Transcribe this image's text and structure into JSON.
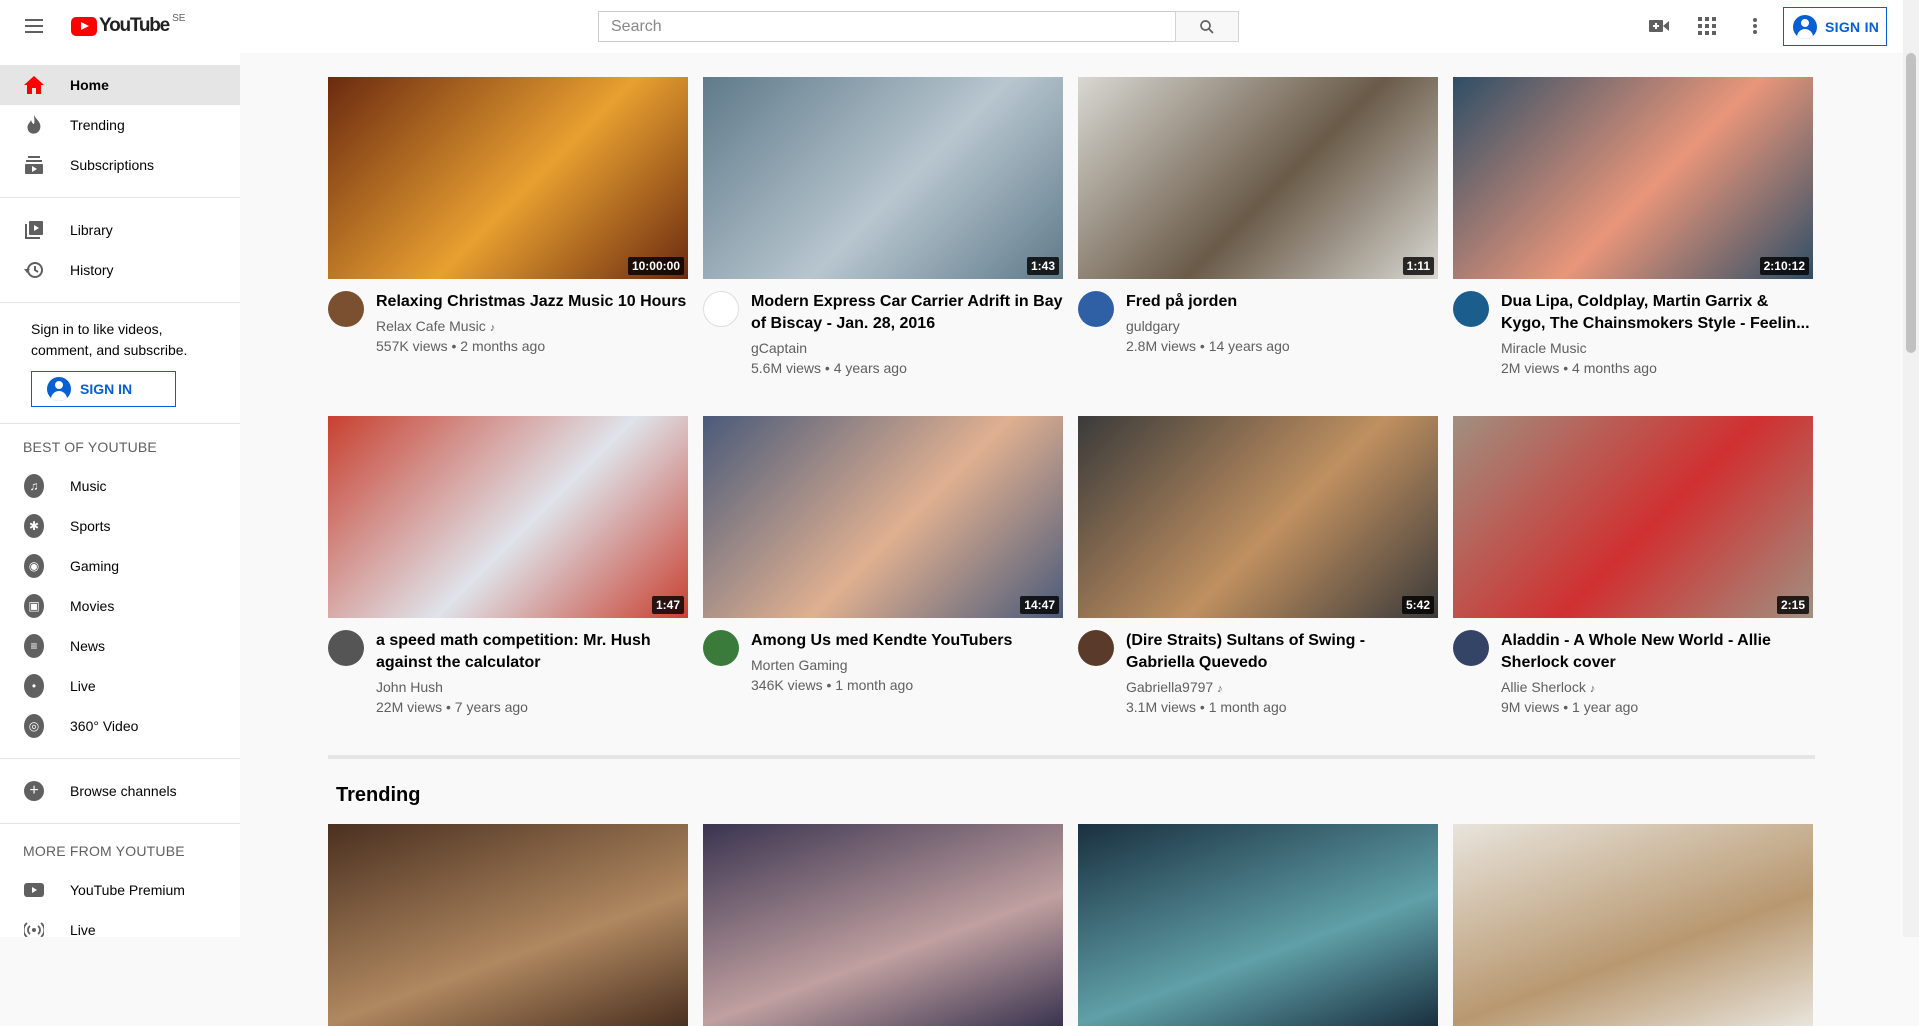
{
  "header": {
    "logo_text": "YouTube",
    "region": "SE",
    "search_placeholder": "Search",
    "signin_label": "SIGN IN"
  },
  "sidebar": {
    "primary": [
      {
        "label": "Home",
        "icon": "home-icon"
      },
      {
        "label": "Trending",
        "icon": "trending-icon"
      },
      {
        "label": "Subscriptions",
        "icon": "subscriptions-icon"
      }
    ],
    "secondary": [
      {
        "label": "Library",
        "icon": "library-icon"
      },
      {
        "label": "History",
        "icon": "history-icon"
      }
    ],
    "signin_note": "Sign in to like videos, comment, and subscribe.",
    "signin_label": "SIGN IN",
    "best_heading": "BEST OF YOUTUBE",
    "best": [
      {
        "label": "Music"
      },
      {
        "label": "Sports"
      },
      {
        "label": "Gaming"
      },
      {
        "label": "Movies"
      },
      {
        "label": "News"
      },
      {
        "label": "Live"
      },
      {
        "label": "360° Video"
      }
    ],
    "browse_label": "Browse channels",
    "more_heading": "MORE FROM YOUTUBE",
    "more": [
      {
        "label": "YouTube Premium"
      },
      {
        "label": "Live"
      }
    ]
  },
  "videos": [
    {
      "title": "Relaxing Christmas Jazz Music 10 Hours",
      "channel": "Relax Cafe Music",
      "note": "♪",
      "stats": "557K views • 2 months ago",
      "duration": "10:00:00",
      "thumb_color": "#6b2a10",
      "thumb_color2": "#e8a030",
      "avatar_color": "#7a5030"
    },
    {
      "title": "Modern Express Car Carrier Adrift in Bay of Biscay - Jan. 28, 2016",
      "channel": "gCaptain",
      "note": "",
      "stats": "5.6M views • 4 years ago",
      "duration": "1:43",
      "thumb_color": "#5f7a8a",
      "thumb_color2": "#b8c6cf",
      "avatar_color": "#ffffff"
    },
    {
      "title": "Fred på jorden",
      "channel": "guldgary",
      "note": "",
      "stats": "2.8M views • 14 years ago",
      "duration": "1:11",
      "thumb_color": "#d8d8d2",
      "thumb_color2": "#6a5a48",
      "avatar_color": "#2f5fa5"
    },
    {
      "title": "Dua Lipa, Coldplay, Martin Garrix & Kygo, The Chainsmokers Style - Feelin...",
      "channel": "Miracle Music",
      "note": "",
      "stats": "2M views • 4 months ago",
      "duration": "2:10:12",
      "thumb_color": "#2e4e66",
      "thumb_color2": "#e9967a",
      "avatar_color": "#1b5e8c"
    },
    {
      "title": "a speed math competition: Mr. Hush against the calculator",
      "channel": "John Hush",
      "note": "",
      "stats": "22M views • 7 years ago",
      "duration": "1:47",
      "thumb_color": "#c84030",
      "thumb_color2": "#dfe3ea",
      "avatar_color": "#555555"
    },
    {
      "title": "Among Us med Kendte YouTubers",
      "channel": "Morten Gaming",
      "note": "",
      "stats": "346K views • 1 month ago",
      "duration": "14:47",
      "thumb_color": "#4a5a7a",
      "thumb_color2": "#e0b090",
      "avatar_color": "#3a7a3a"
    },
    {
      "title": "(Dire Straits) Sultans of Swing - Gabriella Quevedo",
      "channel": "Gabriella9797",
      "note": "♪",
      "stats": "3.1M views • 1 month ago",
      "duration": "5:42",
      "thumb_color": "#3a3a3a",
      "thumb_color2": "#c09060",
      "avatar_color": "#5a3a2a"
    },
    {
      "title": "Aladdin - A Whole New World - Allie Sherlock cover",
      "channel": "Allie Sherlock",
      "note": "♪",
      "stats": "9M views • 1 year ago",
      "duration": "2:15",
      "thumb_color": "#a09080",
      "thumb_color2": "#d03030",
      "avatar_color": "#334466"
    }
  ],
  "trending": {
    "title": "Trending",
    "thumbs": [
      {
        "color": "#4a3020",
        "color2": "#b08860"
      },
      {
        "color": "#3a3450",
        "color2": "#c0a0a0"
      },
      {
        "color": "#1a3040",
        "color2": "#60a0a8"
      },
      {
        "color": "#e8e4dc",
        "color2": "#b89870"
      }
    ]
  }
}
